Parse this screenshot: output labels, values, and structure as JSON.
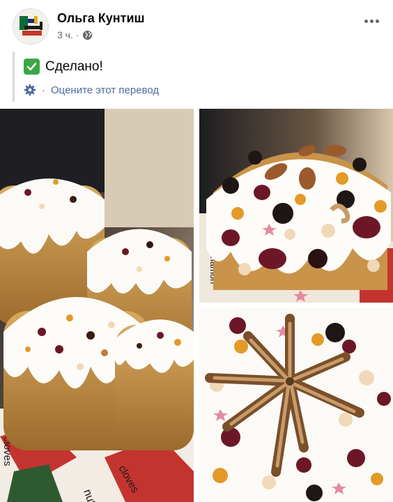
{
  "post": {
    "author": "Ольга Кунтиш",
    "time": "3 ч.",
    "separator": "·"
  },
  "translation": {
    "text": "Сделано!",
    "rate_separator": "·",
    "rate_link": "Оцените этот перевод"
  },
  "photos": {
    "main_towel_words": [
      "cloves",
      "nut",
      "cloves"
    ],
    "top_box_text": "cinnamon"
  },
  "icons": {
    "avatar": "suprematist-painting-avatar",
    "privacy": "globe-icon",
    "check": "check-mark-icon",
    "settings": "gear-icon",
    "more": "more-options-icon"
  },
  "colors": {
    "link": "#4b6a9e",
    "meta": "#65676b",
    "check": "#3ca745"
  }
}
